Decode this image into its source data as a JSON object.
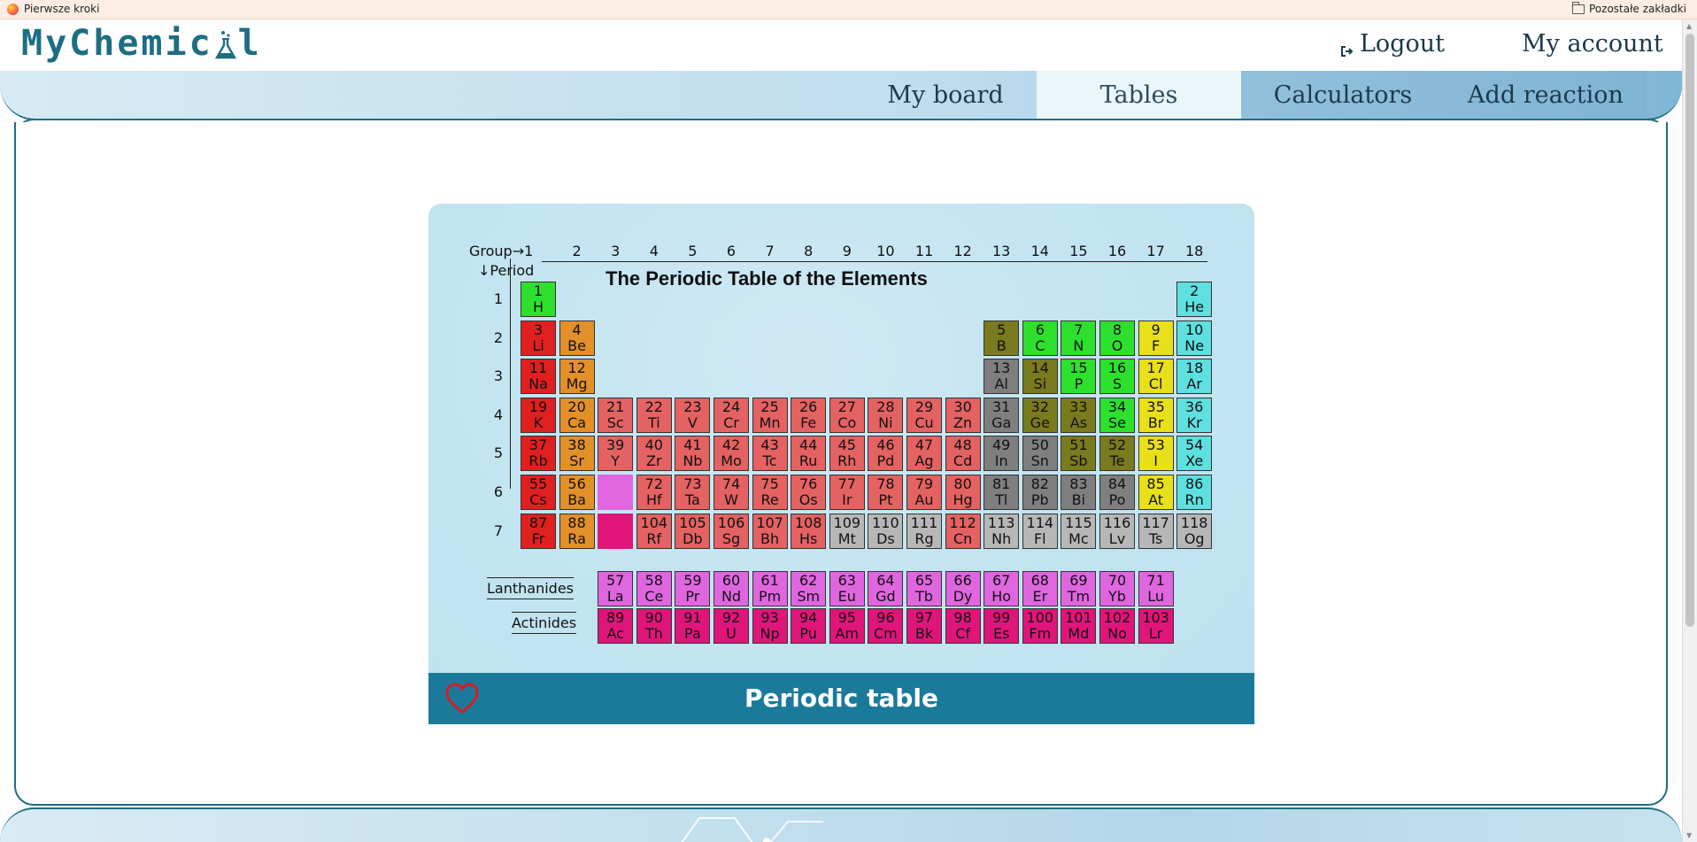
{
  "bookmarks": {
    "left_label": "Pierwsze kroki",
    "right_label": "Pozostałe zakładki"
  },
  "header": {
    "logo_text_1": "MyChemic",
    "logo_text_2": "l",
    "logout_label": "Logout",
    "account_label": "My account"
  },
  "nav": {
    "items": [
      "My board",
      "Tables",
      "Calculators",
      "Add reaction"
    ],
    "active": "Tables"
  },
  "card": {
    "title": "Periodic table",
    "favorite_icon": "heart-outline-icon"
  },
  "periodic_table": {
    "title": "The Periodic Table of the Elements",
    "group_header": "Group→1",
    "period_header": "↓Period",
    "groups": [
      "2",
      "3",
      "4",
      "5",
      "6",
      "7",
      "8",
      "9",
      "10",
      "11",
      "12",
      "13",
      "14",
      "15",
      "16",
      "17",
      "18"
    ],
    "periods": [
      "1",
      "2",
      "3",
      "4",
      "5",
      "6",
      "7"
    ],
    "lanthanides_label": "Lanthanides",
    "actinides_label": "Actinides",
    "category_colors": {
      "alkali": "#e02020",
      "alkaline": "#e3902a",
      "transition": "#e46262",
      "unknown": "#b7b7b7",
      "post_transition": "#7f7f7f",
      "metalloid": "#7a7a1e",
      "nonmetal": "#2ee02e",
      "halogen": "#e9e01a",
      "noble": "#5ee0e0",
      "lanthanide": "#e066e0",
      "actinide": "#e0157a"
    },
    "elements": [
      {
        "n": "1",
        "s": "H",
        "g": 1,
        "p": 1,
        "c": "nonmetal"
      },
      {
        "n": "2",
        "s": "He",
        "g": 18,
        "p": 1,
        "c": "noble"
      },
      {
        "n": "3",
        "s": "Li",
        "g": 1,
        "p": 2,
        "c": "alkali"
      },
      {
        "n": "4",
        "s": "Be",
        "g": 2,
        "p": 2,
        "c": "alkaline"
      },
      {
        "n": "5",
        "s": "B",
        "g": 13,
        "p": 2,
        "c": "metalloid"
      },
      {
        "n": "6",
        "s": "C",
        "g": 14,
        "p": 2,
        "c": "nonmetal"
      },
      {
        "n": "7",
        "s": "N",
        "g": 15,
        "p": 2,
        "c": "nonmetal"
      },
      {
        "n": "8",
        "s": "O",
        "g": 16,
        "p": 2,
        "c": "nonmetal"
      },
      {
        "n": "9",
        "s": "F",
        "g": 17,
        "p": 2,
        "c": "halogen"
      },
      {
        "n": "10",
        "s": "Ne",
        "g": 18,
        "p": 2,
        "c": "noble"
      },
      {
        "n": "11",
        "s": "Na",
        "g": 1,
        "p": 3,
        "c": "alkali"
      },
      {
        "n": "12",
        "s": "Mg",
        "g": 2,
        "p": 3,
        "c": "alkaline"
      },
      {
        "n": "13",
        "s": "Al",
        "g": 13,
        "p": 3,
        "c": "post_transition"
      },
      {
        "n": "14",
        "s": "Si",
        "g": 14,
        "p": 3,
        "c": "metalloid"
      },
      {
        "n": "15",
        "s": "P",
        "g": 15,
        "p": 3,
        "c": "nonmetal"
      },
      {
        "n": "16",
        "s": "S",
        "g": 16,
        "p": 3,
        "c": "nonmetal"
      },
      {
        "n": "17",
        "s": "Cl",
        "g": 17,
        "p": 3,
        "c": "halogen"
      },
      {
        "n": "18",
        "s": "Ar",
        "g": 18,
        "p": 3,
        "c": "noble"
      },
      {
        "n": "19",
        "s": "K",
        "g": 1,
        "p": 4,
        "c": "alkali"
      },
      {
        "n": "20",
        "s": "Ca",
        "g": 2,
        "p": 4,
        "c": "alkaline"
      },
      {
        "n": "21",
        "s": "Sc",
        "g": 3,
        "p": 4,
        "c": "transition"
      },
      {
        "n": "22",
        "s": "Ti",
        "g": 4,
        "p": 4,
        "c": "transition"
      },
      {
        "n": "23",
        "s": "V",
        "g": 5,
        "p": 4,
        "c": "transition"
      },
      {
        "n": "24",
        "s": "Cr",
        "g": 6,
        "p": 4,
        "c": "transition"
      },
      {
        "n": "25",
        "s": "Mn",
        "g": 7,
        "p": 4,
        "c": "transition"
      },
      {
        "n": "26",
        "s": "Fe",
        "g": 8,
        "p": 4,
        "c": "transition"
      },
      {
        "n": "27",
        "s": "Co",
        "g": 9,
        "p": 4,
        "c": "transition"
      },
      {
        "n": "28",
        "s": "Ni",
        "g": 10,
        "p": 4,
        "c": "transition"
      },
      {
        "n": "29",
        "s": "Cu",
        "g": 11,
        "p": 4,
        "c": "transition"
      },
      {
        "n": "30",
        "s": "Zn",
        "g": 12,
        "p": 4,
        "c": "transition"
      },
      {
        "n": "31",
        "s": "Ga",
        "g": 13,
        "p": 4,
        "c": "post_transition"
      },
      {
        "n": "32",
        "s": "Ge",
        "g": 14,
        "p": 4,
        "c": "metalloid"
      },
      {
        "n": "33",
        "s": "As",
        "g": 15,
        "p": 4,
        "c": "metalloid"
      },
      {
        "n": "34",
        "s": "Se",
        "g": 16,
        "p": 4,
        "c": "nonmetal"
      },
      {
        "n": "35",
        "s": "Br",
        "g": 17,
        "p": 4,
        "c": "halogen"
      },
      {
        "n": "36",
        "s": "Kr",
        "g": 18,
        "p": 4,
        "c": "noble"
      },
      {
        "n": "37",
        "s": "Rb",
        "g": 1,
        "p": 5,
        "c": "alkali"
      },
      {
        "n": "38",
        "s": "Sr",
        "g": 2,
        "p": 5,
        "c": "alkaline"
      },
      {
        "n": "39",
        "s": "Y",
        "g": 3,
        "p": 5,
        "c": "transition"
      },
      {
        "n": "40",
        "s": "Zr",
        "g": 4,
        "p": 5,
        "c": "transition"
      },
      {
        "n": "41",
        "s": "Nb",
        "g": 5,
        "p": 5,
        "c": "transition"
      },
      {
        "n": "42",
        "s": "Mo",
        "g": 6,
        "p": 5,
        "c": "transition"
      },
      {
        "n": "43",
        "s": "Tc",
        "g": 7,
        "p": 5,
        "c": "transition"
      },
      {
        "n": "44",
        "s": "Ru",
        "g": 8,
        "p": 5,
        "c": "transition"
      },
      {
        "n": "45",
        "s": "Rh",
        "g": 9,
        "p": 5,
        "c": "transition"
      },
      {
        "n": "46",
        "s": "Pd",
        "g": 10,
        "p": 5,
        "c": "transition"
      },
      {
        "n": "47",
        "s": "Ag",
        "g": 11,
        "p": 5,
        "c": "transition"
      },
      {
        "n": "48",
        "s": "Cd",
        "g": 12,
        "p": 5,
        "c": "transition"
      },
      {
        "n": "49",
        "s": "In",
        "g": 13,
        "p": 5,
        "c": "post_transition"
      },
      {
        "n": "50",
        "s": "Sn",
        "g": 14,
        "p": 5,
        "c": "post_transition"
      },
      {
        "n": "51",
        "s": "Sb",
        "g": 15,
        "p": 5,
        "c": "metalloid"
      },
      {
        "n": "52",
        "s": "Te",
        "g": 16,
        "p": 5,
        "c": "metalloid"
      },
      {
        "n": "53",
        "s": "I",
        "g": 17,
        "p": 5,
        "c": "halogen"
      },
      {
        "n": "54",
        "s": "Xe",
        "g": 18,
        "p": 5,
        "c": "noble"
      },
      {
        "n": "55",
        "s": "Cs",
        "g": 1,
        "p": 6,
        "c": "alkali"
      },
      {
        "n": "56",
        "s": "Ba",
        "g": 2,
        "p": 6,
        "c": "alkaline"
      },
      {
        "n": "",
        "s": "",
        "g": 3,
        "p": 6,
        "c": "lanthanide"
      },
      {
        "n": "72",
        "s": "Hf",
        "g": 4,
        "p": 6,
        "c": "transition"
      },
      {
        "n": "73",
        "s": "Ta",
        "g": 5,
        "p": 6,
        "c": "transition"
      },
      {
        "n": "74",
        "s": "W",
        "g": 6,
        "p": 6,
        "c": "transition"
      },
      {
        "n": "75",
        "s": "Re",
        "g": 7,
        "p": 6,
        "c": "transition"
      },
      {
        "n": "76",
        "s": "Os",
        "g": 8,
        "p": 6,
        "c": "transition"
      },
      {
        "n": "77",
        "s": "Ir",
        "g": 9,
        "p": 6,
        "c": "transition"
      },
      {
        "n": "78",
        "s": "Pt",
        "g": 10,
        "p": 6,
        "c": "transition"
      },
      {
        "n": "79",
        "s": "Au",
        "g": 11,
        "p": 6,
        "c": "transition"
      },
      {
        "n": "80",
        "s": "Hg",
        "g": 12,
        "p": 6,
        "c": "transition"
      },
      {
        "n": "81",
        "s": "Tl",
        "g": 13,
        "p": 6,
        "c": "post_transition"
      },
      {
        "n": "82",
        "s": "Pb",
        "g": 14,
        "p": 6,
        "c": "post_transition"
      },
      {
        "n": "83",
        "s": "Bi",
        "g": 15,
        "p": 6,
        "c": "post_transition"
      },
      {
        "n": "84",
        "s": "Po",
        "g": 16,
        "p": 6,
        "c": "post_transition"
      },
      {
        "n": "85",
        "s": "At",
        "g": 17,
        "p": 6,
        "c": "halogen"
      },
      {
        "n": "86",
        "s": "Rn",
        "g": 18,
        "p": 6,
        "c": "noble"
      },
      {
        "n": "87",
        "s": "Fr",
        "g": 1,
        "p": 7,
        "c": "alkali"
      },
      {
        "n": "88",
        "s": "Ra",
        "g": 2,
        "p": 7,
        "c": "alkaline"
      },
      {
        "n": "",
        "s": "",
        "g": 3,
        "p": 7,
        "c": "actinide"
      },
      {
        "n": "104",
        "s": "Rf",
        "g": 4,
        "p": 7,
        "c": "transition"
      },
      {
        "n": "105",
        "s": "Db",
        "g": 5,
        "p": 7,
        "c": "transition"
      },
      {
        "n": "106",
        "s": "Sg",
        "g": 6,
        "p": 7,
        "c": "transition"
      },
      {
        "n": "107",
        "s": "Bh",
        "g": 7,
        "p": 7,
        "c": "transition"
      },
      {
        "n": "108",
        "s": "Hs",
        "g": 8,
        "p": 7,
        "c": "transition"
      },
      {
        "n": "109",
        "s": "Mt",
        "g": 9,
        "p": 7,
        "c": "unknown"
      },
      {
        "n": "110",
        "s": "Ds",
        "g": 10,
        "p": 7,
        "c": "unknown"
      },
      {
        "n": "111",
        "s": "Rg",
        "g": 11,
        "p": 7,
        "c": "unknown"
      },
      {
        "n": "112",
        "s": "Cn",
        "g": 12,
        "p": 7,
        "c": "transition"
      },
      {
        "n": "113",
        "s": "Nh",
        "g": 13,
        "p": 7,
        "c": "unknown"
      },
      {
        "n": "114",
        "s": "Fl",
        "g": 14,
        "p": 7,
        "c": "unknown"
      },
      {
        "n": "115",
        "s": "Mc",
        "g": 15,
        "p": 7,
        "c": "unknown"
      },
      {
        "n": "116",
        "s": "Lv",
        "g": 16,
        "p": 7,
        "c": "unknown"
      },
      {
        "n": "117",
        "s": "Ts",
        "g": 17,
        "p": 7,
        "c": "unknown"
      },
      {
        "n": "118",
        "s": "Og",
        "g": 18,
        "p": 7,
        "c": "unknown"
      }
    ],
    "lanthanides": [
      [
        "57",
        "La"
      ],
      [
        "58",
        "Ce"
      ],
      [
        "59",
        "Pr"
      ],
      [
        "60",
        "Nd"
      ],
      [
        "61",
        "Pm"
      ],
      [
        "62",
        "Sm"
      ],
      [
        "63",
        "Eu"
      ],
      [
        "64",
        "Gd"
      ],
      [
        "65",
        "Tb"
      ],
      [
        "66",
        "Dy"
      ],
      [
        "67",
        "Ho"
      ],
      [
        "68",
        "Er"
      ],
      [
        "69",
        "Tm"
      ],
      [
        "70",
        "Yb"
      ],
      [
        "71",
        "Lu"
      ]
    ],
    "actinides": [
      [
        "89",
        "Ac"
      ],
      [
        "90",
        "Th"
      ],
      [
        "91",
        "Pa"
      ],
      [
        "92",
        "U"
      ],
      [
        "93",
        "Np"
      ],
      [
        "94",
        "Pu"
      ],
      [
        "95",
        "Am"
      ],
      [
        "96",
        "Cm"
      ],
      [
        "97",
        "Bk"
      ],
      [
        "98",
        "Cf"
      ],
      [
        "99",
        "Es"
      ],
      [
        "100",
        "Fm"
      ],
      [
        "101",
        "Md"
      ],
      [
        "102",
        "No"
      ],
      [
        "103",
        "Lr"
      ]
    ]
  }
}
